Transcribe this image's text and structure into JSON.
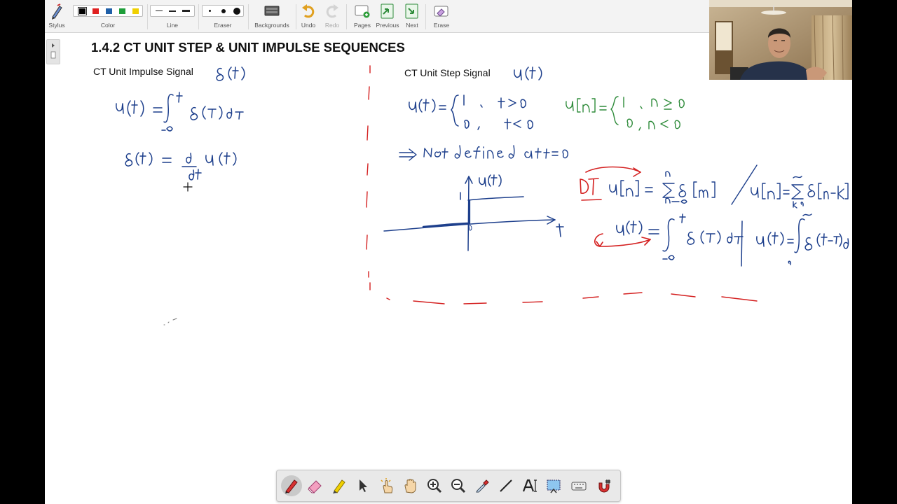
{
  "toolbar": {
    "stylus_label": "Stylus",
    "color_label": "Color",
    "line_label": "Line",
    "eraser_label": "Eraser",
    "backgrounds_label": "Backgrounds",
    "undo_label": "Undo",
    "redo_label": "Redo",
    "pages_label": "Pages",
    "previous_label": "Previous",
    "next_label": "Next",
    "erase_label": "Erase",
    "colors": [
      "#000000",
      "#e02020",
      "#1f5fa8",
      "#1e9e3a",
      "#f0d000"
    ],
    "selected_color": "#000000"
  },
  "slide": {
    "title": "1.4.2 CT UNIT STEP & UNIT IMPULSE SEQUENCES",
    "impulse_label": "CT Unit Impulse Signal",
    "step_label": "CT Unit Step Signal"
  },
  "ink_colors": {
    "black": "#1c1c1c",
    "blue": "#1d3f8c",
    "green": "#2e8b3a",
    "red": "#d42020"
  },
  "bottom_toolbar": {
    "tools": [
      "pen-icon",
      "highlighter-eraser-icon",
      "highlighter-icon",
      "pointer-icon",
      "click-hand-icon",
      "pan-hand-icon",
      "zoom-in-icon",
      "zoom-out-icon",
      "eyedropper-icon",
      "line-tool-icon",
      "text-tool-icon",
      "screenshot-icon",
      "keyboard-icon",
      "magnet-icon"
    ],
    "active_tool": "pen-icon"
  }
}
